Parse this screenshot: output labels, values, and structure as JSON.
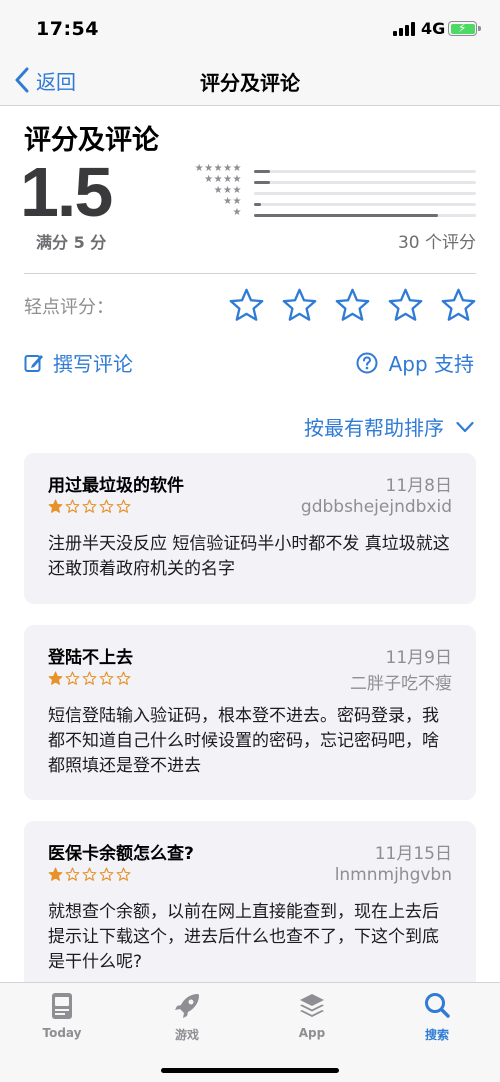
{
  "status_bar": {
    "time": "17:54",
    "network": "4G"
  },
  "nav": {
    "back_label": "返回",
    "title": "评分及评论"
  },
  "ratings": {
    "section_title": "评分及评论",
    "average": "1.5",
    "out_of": "满分 5 分",
    "count_label": "30 个评分",
    "histogram": [
      {
        "stars": "★★★★★",
        "fraction": 0.07
      },
      {
        "stars": "★★★★",
        "fraction": 0.07
      },
      {
        "stars": "★★★",
        "fraction": 0.0
      },
      {
        "stars": "★★",
        "fraction": 0.03
      },
      {
        "stars": "★",
        "fraction": 0.83
      }
    ]
  },
  "tap_to_rate": {
    "label": "轻点评分：",
    "max_stars": 5
  },
  "actions": {
    "write_review": "撰写评论",
    "app_support": "App 支持",
    "sort_label": "按最有帮助排序"
  },
  "reviews": [
    {
      "title": "用过最垃圾的软件",
      "date": "11月8日",
      "author": "gdbbshejejndbxid",
      "rating": 1,
      "body": "注册半天没反应 短信验证码半小时都不发 真垃圾就这还敢顶着政府机关的名字"
    },
    {
      "title": "登陆不上去",
      "date": "11月9日",
      "author": "二胖子吃不瘦",
      "rating": 1,
      "body": "短信登陆输入验证码，根本登不进去。密码登录，我都不知道自己什么时候设置的密码，忘记密码吧，啥都照填还是登不进去"
    },
    {
      "title": "医保卡余额怎么查?",
      "date": "11月15日",
      "author": "lnmnmjhgvbn",
      "rating": 1,
      "body": "就想查个余额，以前在网上直接能查到，现在上去后提示让下载这个，进去后什么也查不了，下这个到底是干什么呢?"
    }
  ],
  "tab_bar": {
    "tabs": [
      {
        "label": "Today",
        "icon": "today-icon"
      },
      {
        "label": "游戏",
        "icon": "rocket-icon"
      },
      {
        "label": "App",
        "icon": "apps-stack-icon"
      },
      {
        "label": "搜索",
        "icon": "search-icon",
        "active": true
      }
    ]
  },
  "colors": {
    "accent": "#2f7bd6",
    "card_bg": "#f2f2f7",
    "star_fill": "#e8922a"
  }
}
